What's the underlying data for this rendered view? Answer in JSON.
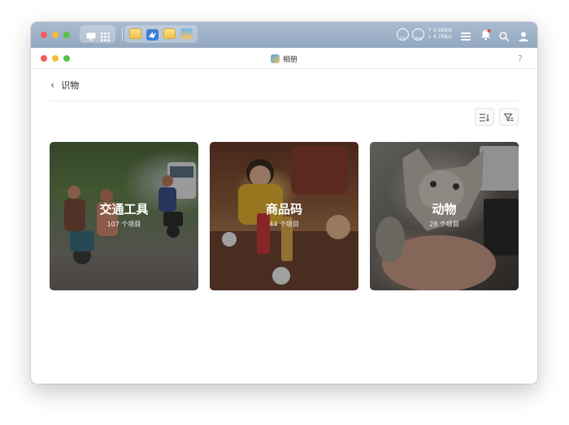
{
  "desktop": {
    "cpu_label": "CPU",
    "ram_label": "RAM",
    "upload_speed": "↑ 9.5KB/s",
    "download_speed": "↓ 4.7KB/s"
  },
  "window": {
    "title": "相册",
    "help_label": "?"
  },
  "breadcrumb": {
    "back_label": "‹",
    "title": "识物"
  },
  "cards": [
    {
      "title": "交通工具",
      "count": "107 个项目"
    },
    {
      "title": "商品码",
      "count": "44 个项目"
    },
    {
      "title": "动物",
      "count": "28 个项目"
    }
  ],
  "colors": {
    "desktop_bar": "#9fb2c8",
    "close": "#ee5f57",
    "minimize": "#f4bd3c",
    "maximize": "#58c442",
    "notification_dot": "#e8463b"
  }
}
